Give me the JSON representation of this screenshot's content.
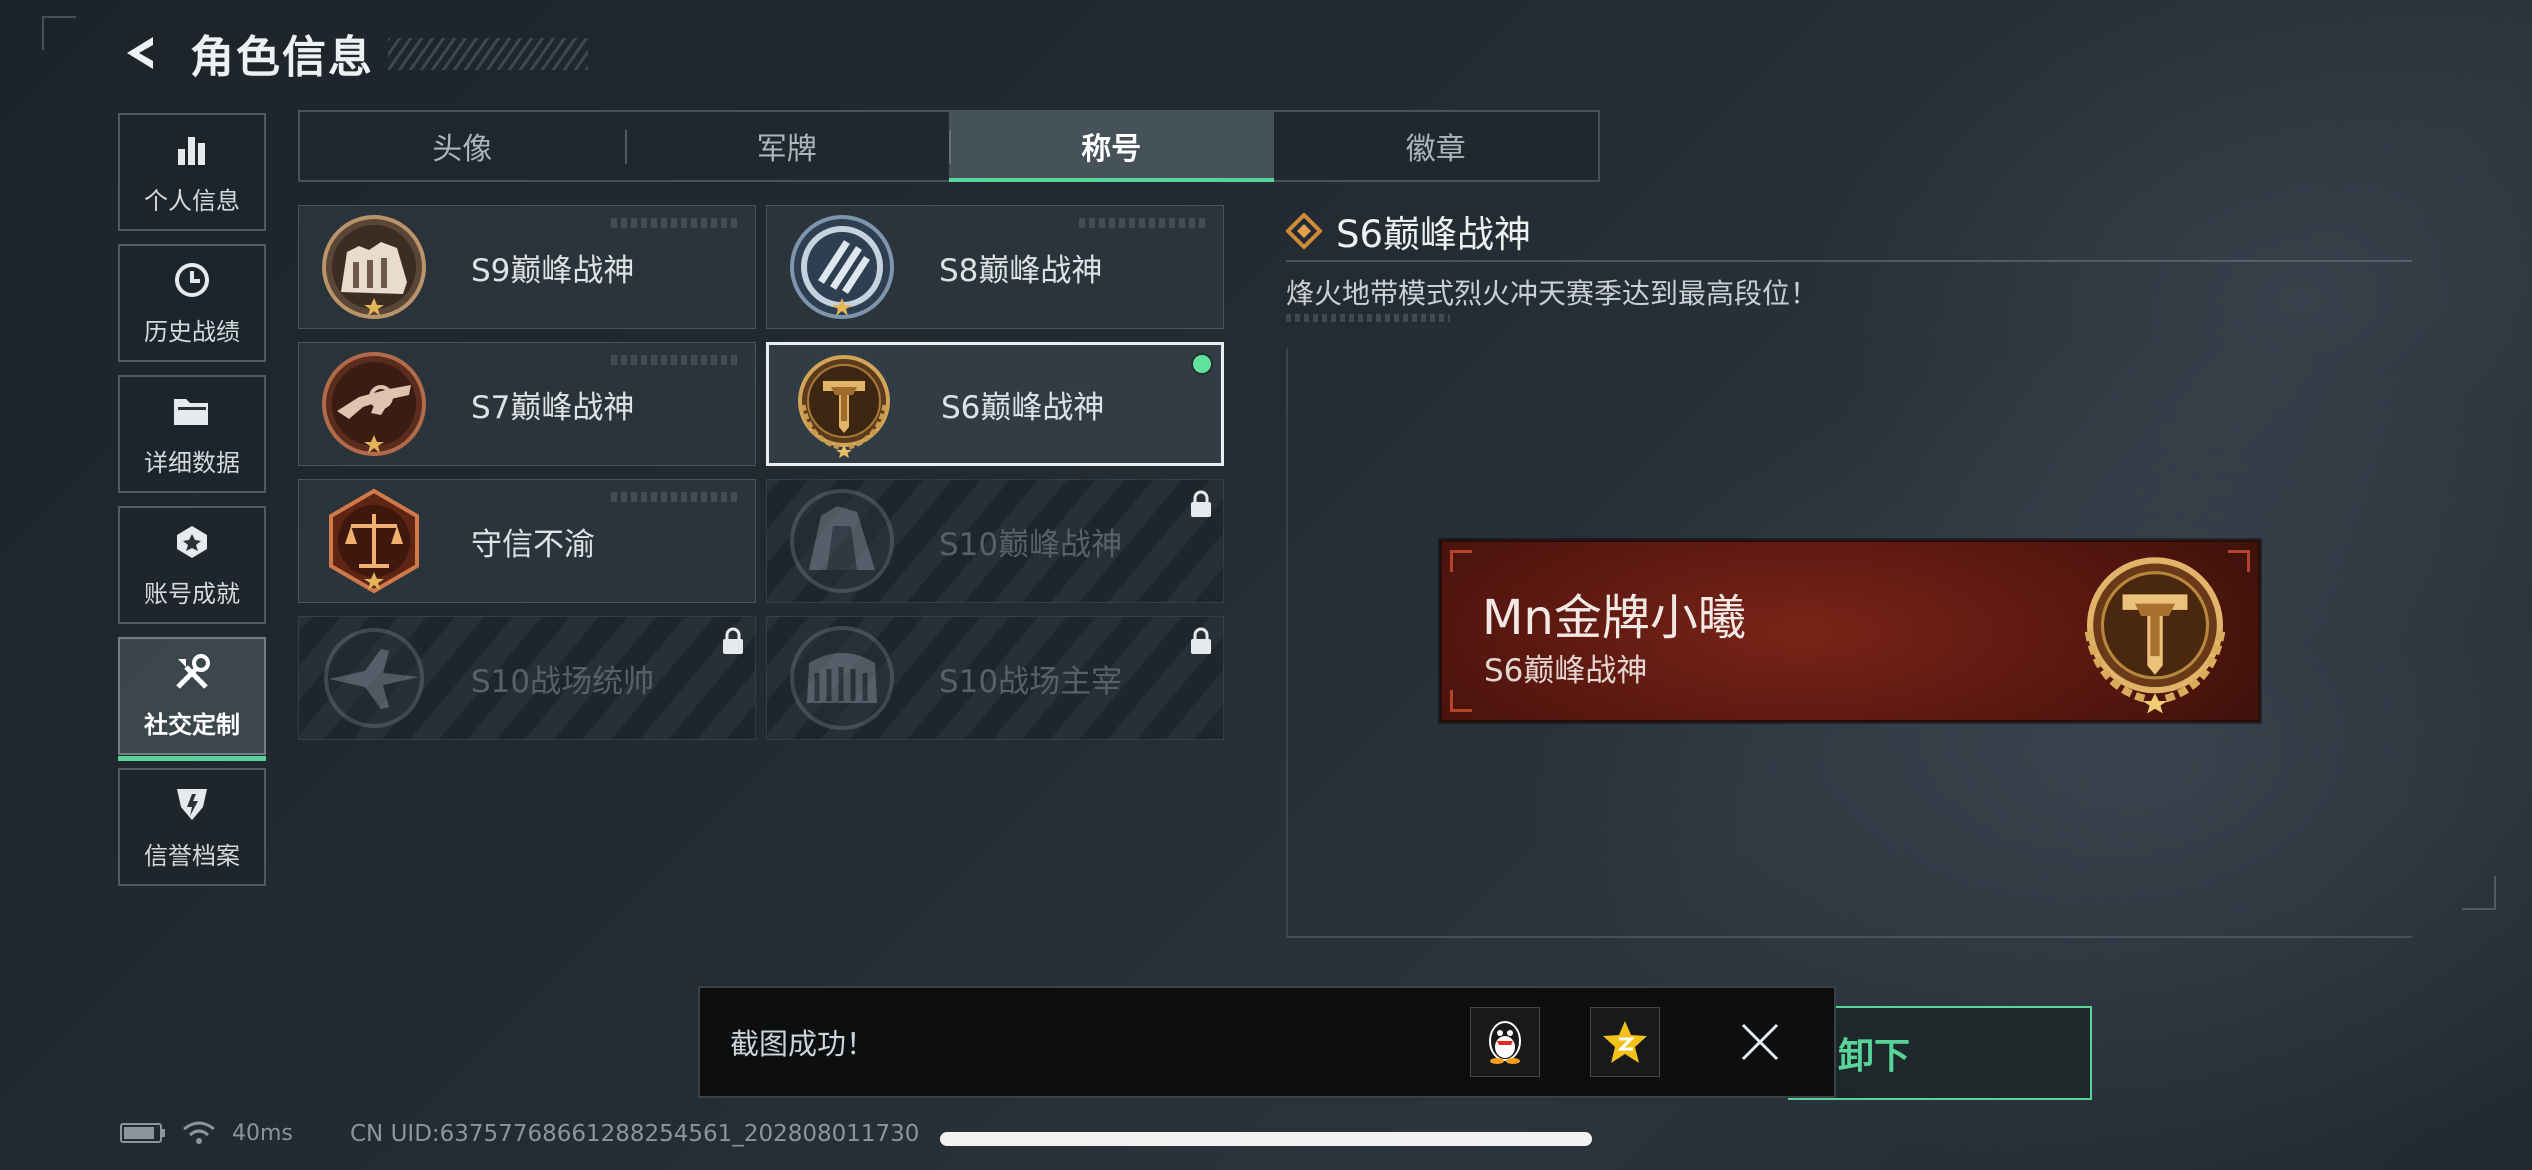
{
  "header": {
    "title": "角色信息"
  },
  "nav": [
    {
      "label": "个人信息",
      "icon": "bar-chart-icon",
      "active": false
    },
    {
      "label": "历史战绩",
      "icon": "clock-history-icon",
      "active": false
    },
    {
      "label": "详细数据",
      "icon": "folder-icon",
      "active": false
    },
    {
      "label": "账号成就",
      "icon": "achievement-icon",
      "active": false
    },
    {
      "label": "社交定制",
      "icon": "tools-icon",
      "active": true
    },
    {
      "label": "信誉档案",
      "icon": "credit-shield-icon",
      "active": false
    }
  ],
  "tabs": [
    {
      "label": "头像",
      "active": false
    },
    {
      "label": "军牌",
      "active": false
    },
    {
      "label": "称号",
      "active": true
    },
    {
      "label": "徽章",
      "active": false
    }
  ],
  "titles": [
    {
      "name": "S9巅峰战神",
      "badge": "s9-fortress-badge-icon",
      "locked": false,
      "selected": false,
      "equipped": false
    },
    {
      "name": "S8巅峰战神",
      "badge": "s8-emblem-badge-icon",
      "locked": false,
      "selected": false,
      "equipped": false
    },
    {
      "name": "S7巅峰战神",
      "badge": "s7-weapon-badge-icon",
      "locked": false,
      "selected": false,
      "equipped": false
    },
    {
      "name": "S6巅峰战神",
      "badge": "s6-laurel-badge-icon",
      "locked": false,
      "selected": true,
      "equipped": true
    },
    {
      "name": "守信不渝",
      "badge": "scales-badge-icon",
      "locked": false,
      "selected": false,
      "equipped": false
    },
    {
      "name": "S10巅峰战神",
      "badge": "s10-tower-badge-icon",
      "locked": true,
      "selected": false,
      "equipped": false
    },
    {
      "name": "S10战场统帅",
      "badge": "s10-aircraft-badge-icon",
      "locked": true,
      "selected": false,
      "equipped": false
    },
    {
      "name": "S10战场主宰",
      "badge": "s10-colosseum-badge-icon",
      "locked": true,
      "selected": false,
      "equipped": false
    }
  ],
  "detail": {
    "title": "S6巅峰战神",
    "description": "烽火地带模式烈火冲天赛季达到最高段位！",
    "nameplate": {
      "player_name": "Mn金牌小曦",
      "title": "S6巅峰战神"
    },
    "action_label": "卸下"
  },
  "toast": {
    "message": "截图成功！",
    "share_targets": [
      "qq-penguin-icon",
      "qzone-star-icon"
    ]
  },
  "status": {
    "ping": "40ms",
    "uid": "CN UID:637577686612882545​61_202808011730"
  },
  "colors": {
    "accent": "#58d49a",
    "nameplate": "#6b1f14",
    "gold": "#c99a4a"
  }
}
